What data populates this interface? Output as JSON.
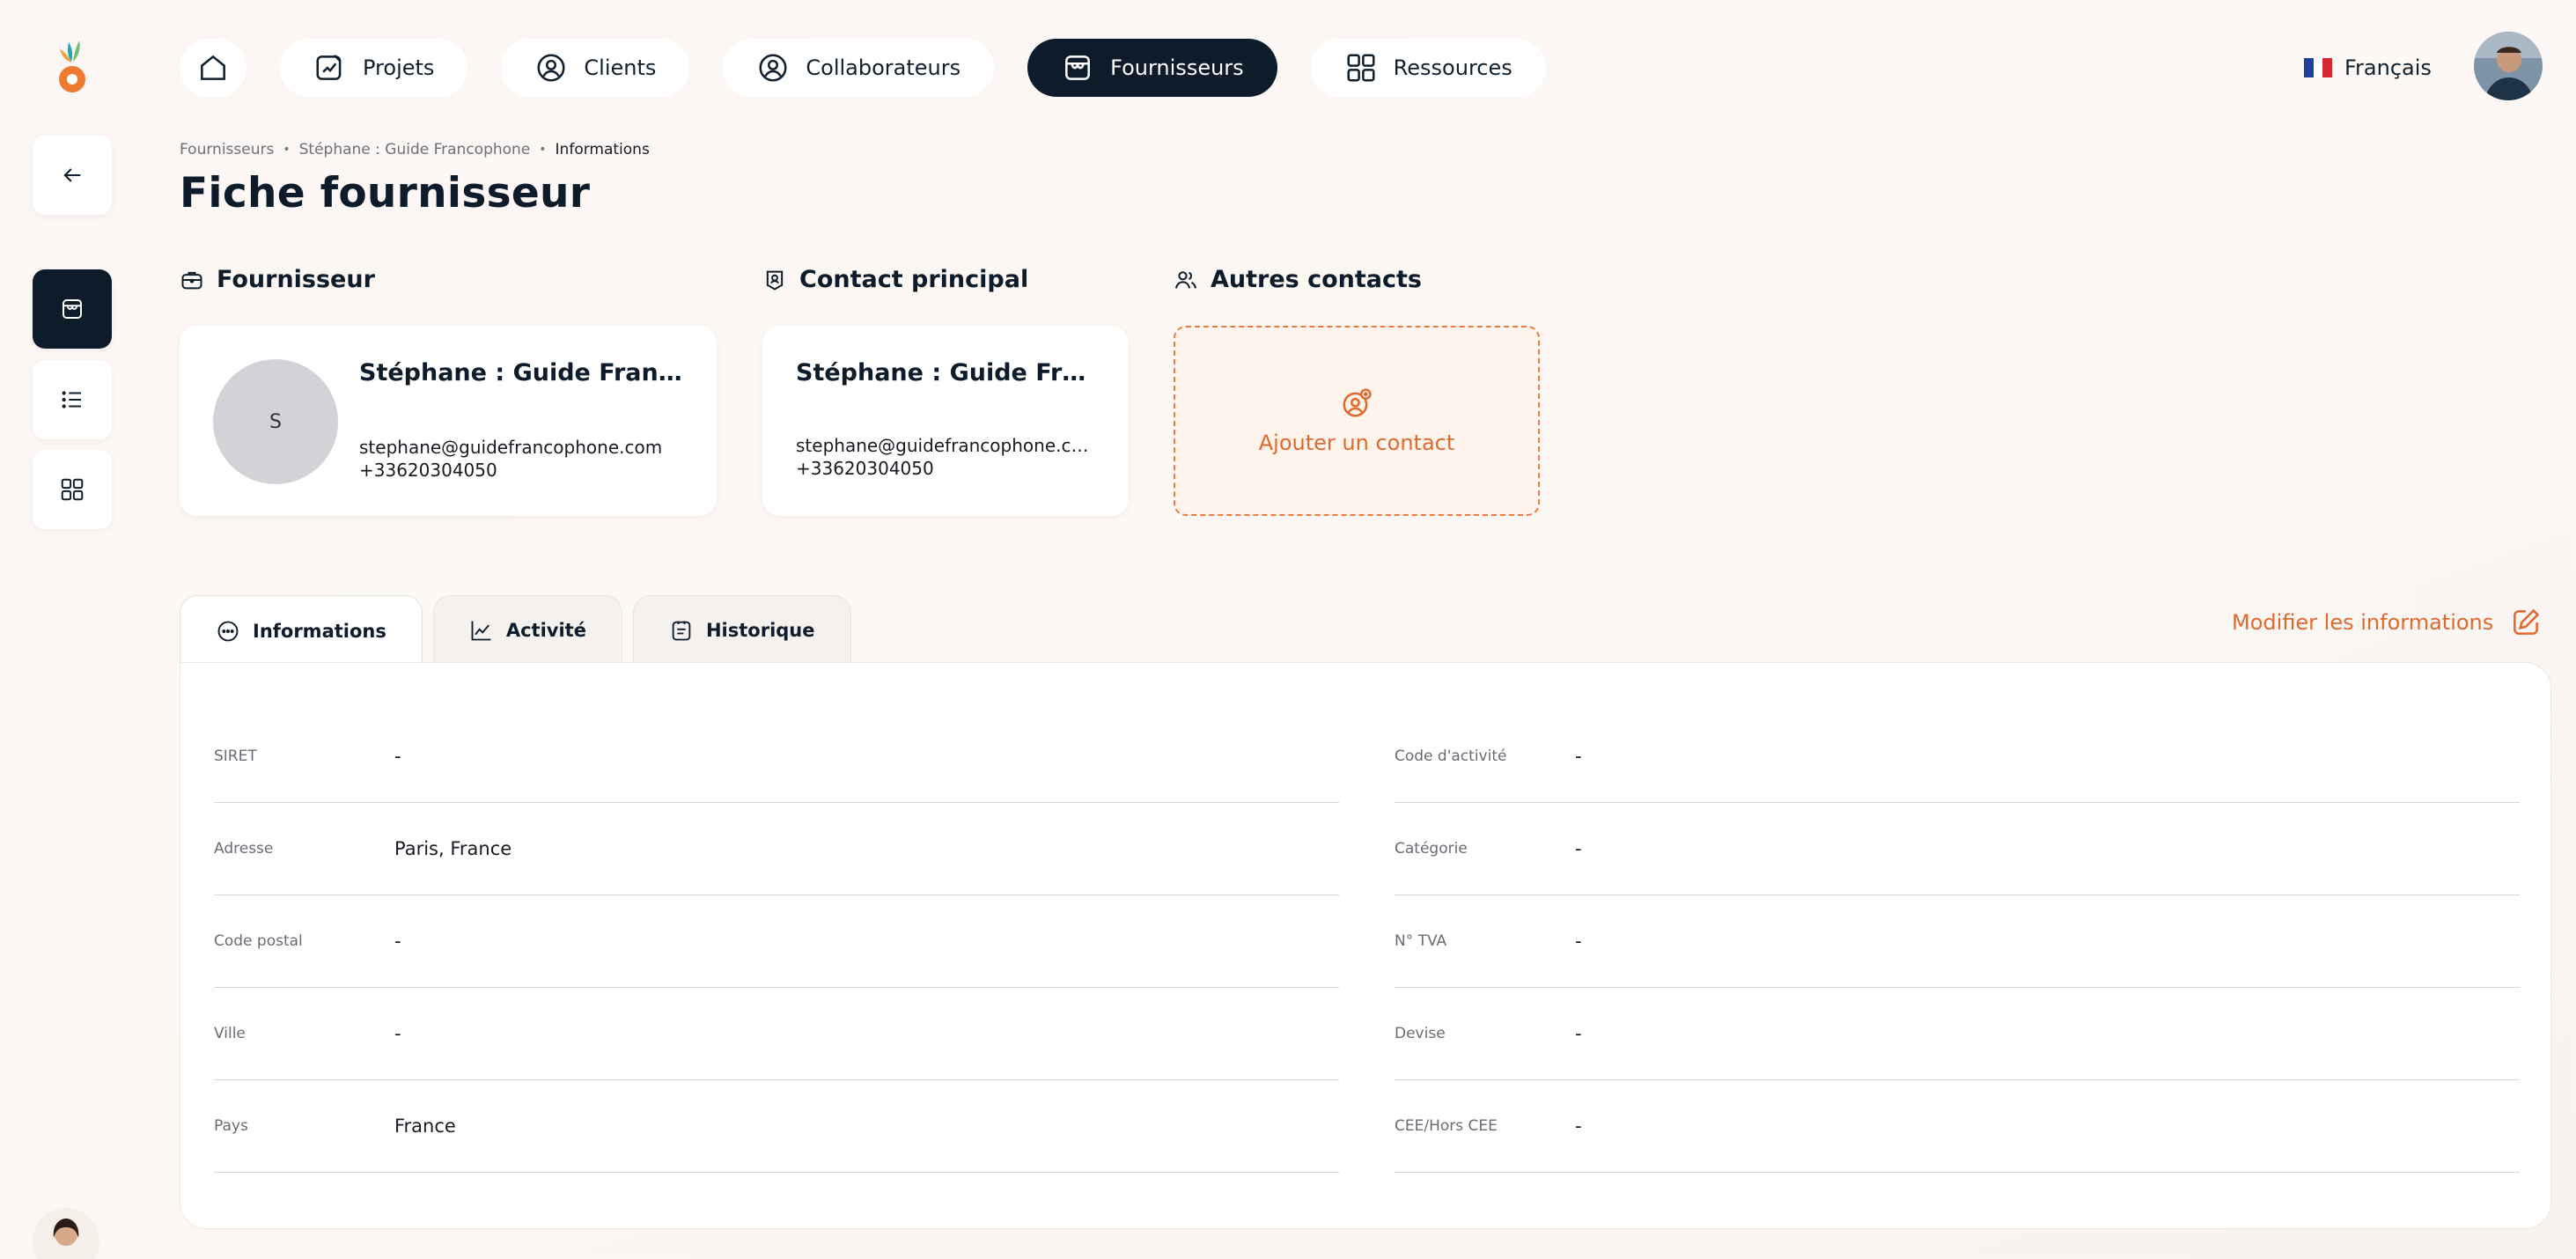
{
  "nav": {
    "items": [
      {
        "label": "Projets",
        "icon": "project-edit-icon"
      },
      {
        "label": "Clients",
        "icon": "user-circle-icon"
      },
      {
        "label": "Collaborateurs",
        "icon": "user-circle-icon"
      },
      {
        "label": "Fournisseurs",
        "icon": "store-icon",
        "active": true
      },
      {
        "label": "Ressources",
        "icon": "grid-icon"
      }
    ],
    "language": "Français"
  },
  "breadcrumb": [
    "Fournisseurs",
    "Stéphane : Guide Francophone",
    "Informations"
  ],
  "page_title": "Fiche fournisseur",
  "sections": {
    "supplier": "Fournisseur",
    "main_contact": "Contact principal",
    "other_contacts": "Autres contacts"
  },
  "supplier": {
    "initial": "S",
    "name": "Stéphane : Guide Francophone",
    "email": "stephane@guidefrancophone.com",
    "phone": "+33620304050"
  },
  "main_contact": {
    "name": "Stéphane : Guide Francophone",
    "email": "stephane@guidefrancophone.com",
    "phone": "+33620304050"
  },
  "add_contact_label": "Ajouter un contact",
  "tabs": [
    "Informations",
    "Activité",
    "Historique"
  ],
  "edit_label": "Modifier les informations",
  "info": {
    "left": [
      {
        "label": "SIRET",
        "value": "-"
      },
      {
        "label": "Adresse",
        "value": "Paris, France"
      },
      {
        "label": "Code postal",
        "value": "-"
      },
      {
        "label": "Ville",
        "value": "-"
      },
      {
        "label": "Pays",
        "value": "France"
      }
    ],
    "right": [
      {
        "label": "Code d'activité",
        "value": "-"
      },
      {
        "label": "Catégorie",
        "value": "-"
      },
      {
        "label": "N° TVA",
        "value": "-"
      },
      {
        "label": "Devise",
        "value": "-"
      },
      {
        "label": "CEE/Hors CEE",
        "value": "-"
      }
    ]
  },
  "colors": {
    "accent": "#df6a2f",
    "dark": "#0d1b2a",
    "muted": "#6b6b74"
  }
}
